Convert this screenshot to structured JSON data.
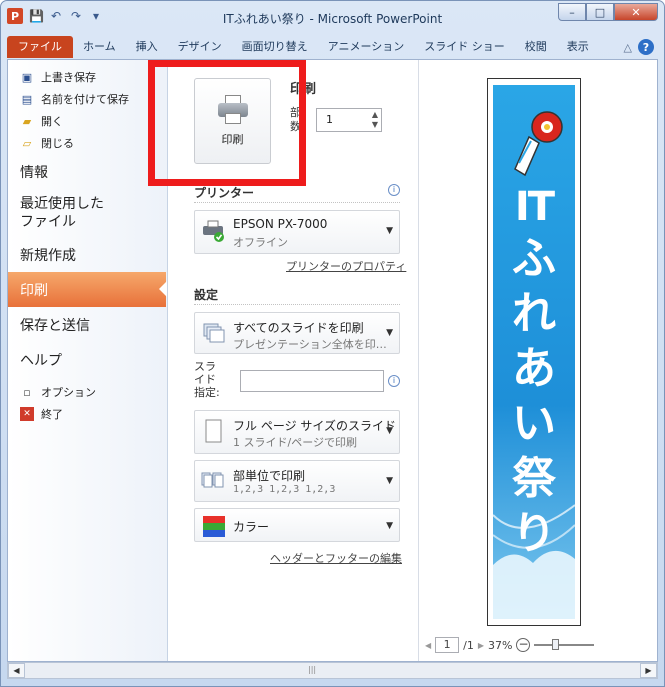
{
  "window": {
    "title": "ITふれあい祭り - Microsoft PowerPoint",
    "app_icon": "P",
    "controls": [
      "–",
      "□",
      "✕"
    ]
  },
  "qat": {
    "save": "💾",
    "undo": "↶",
    "redo": "↷",
    "customize": "▾"
  },
  "ribbon": {
    "tabs": [
      "ファイル",
      "ホーム",
      "挿入",
      "デザイン",
      "画面切り替え",
      "アニメーション",
      "スライド ショー",
      "校閲",
      "表示"
    ],
    "minimize_caret": "△",
    "help": "?"
  },
  "backstage": {
    "small_items": [
      "上書き保存",
      "名前を付けて保存",
      "開く",
      "閉じる"
    ],
    "big_items": [
      "情報",
      "最近使用した ファイル",
      "新規作成",
      "印刷",
      "保存と送信",
      "ヘルプ"
    ],
    "active": "印刷",
    "bottom_items": [
      "オプション",
      "終了"
    ]
  },
  "print": {
    "button_label": "印刷",
    "header": "印刷",
    "copies_label": "部数:",
    "copies_value": "1",
    "printer_header": "プリンター",
    "printer_name": "EPSON PX-7000",
    "printer_status": "オフライン",
    "printer_props_link": "プリンターのプロパティ",
    "settings_header": "設定",
    "slides_range_main": "すべてのスライドを印刷",
    "slides_range_sub": "プレゼンテーション全体を印…",
    "slides_label": "スライド指定:",
    "slides_value": "",
    "layout_main": "フル ページ サイズのスライド",
    "layout_sub": "1 スライド/ページで印刷",
    "collate_main": "部単位で印刷",
    "collate_sub": "1,2,3   1,2,3   1,2,3",
    "color_main": "カラー",
    "header_footer_link": "ヘッダーとフッターの編集"
  },
  "preview": {
    "slide_title_latin": "IT",
    "slide_title_chars": [
      "ふ",
      "れ",
      "あ",
      "い",
      "祭",
      "り"
    ],
    "page_current": "1",
    "page_total": "/1",
    "zoom": "37%"
  },
  "colors": {
    "file_tab": "#c8441e",
    "active_nav": "#e8713a",
    "highlight_frame": "#ee1c1c",
    "slide_blue": "#1e8fd8"
  }
}
